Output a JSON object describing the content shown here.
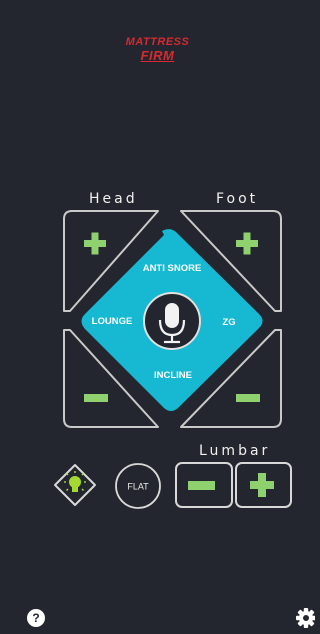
{
  "brand": {
    "line1": "MATTRESS",
    "line2": "FIRM"
  },
  "labels": {
    "head": "Head",
    "foot": "Foot",
    "lumbar": "Lumbar"
  },
  "modes": {
    "top": "ANTI SNORE",
    "left": "LOUNGE",
    "right": "ZG",
    "bottom": "INCLINE"
  },
  "flat_button": {
    "label": "FLAT"
  },
  "colors": {
    "background": "#23262e",
    "outline": "#c9c9c9",
    "accent_green": "#8fd16f",
    "center_teal": "#17b8d2",
    "brand_red": "#d9282f",
    "light_bulb": "#a4d930"
  },
  "icons": {
    "help": "question-circle-icon",
    "settings": "gear-icon",
    "mic": "microphone-icon",
    "light": "light-bulb-icon"
  }
}
